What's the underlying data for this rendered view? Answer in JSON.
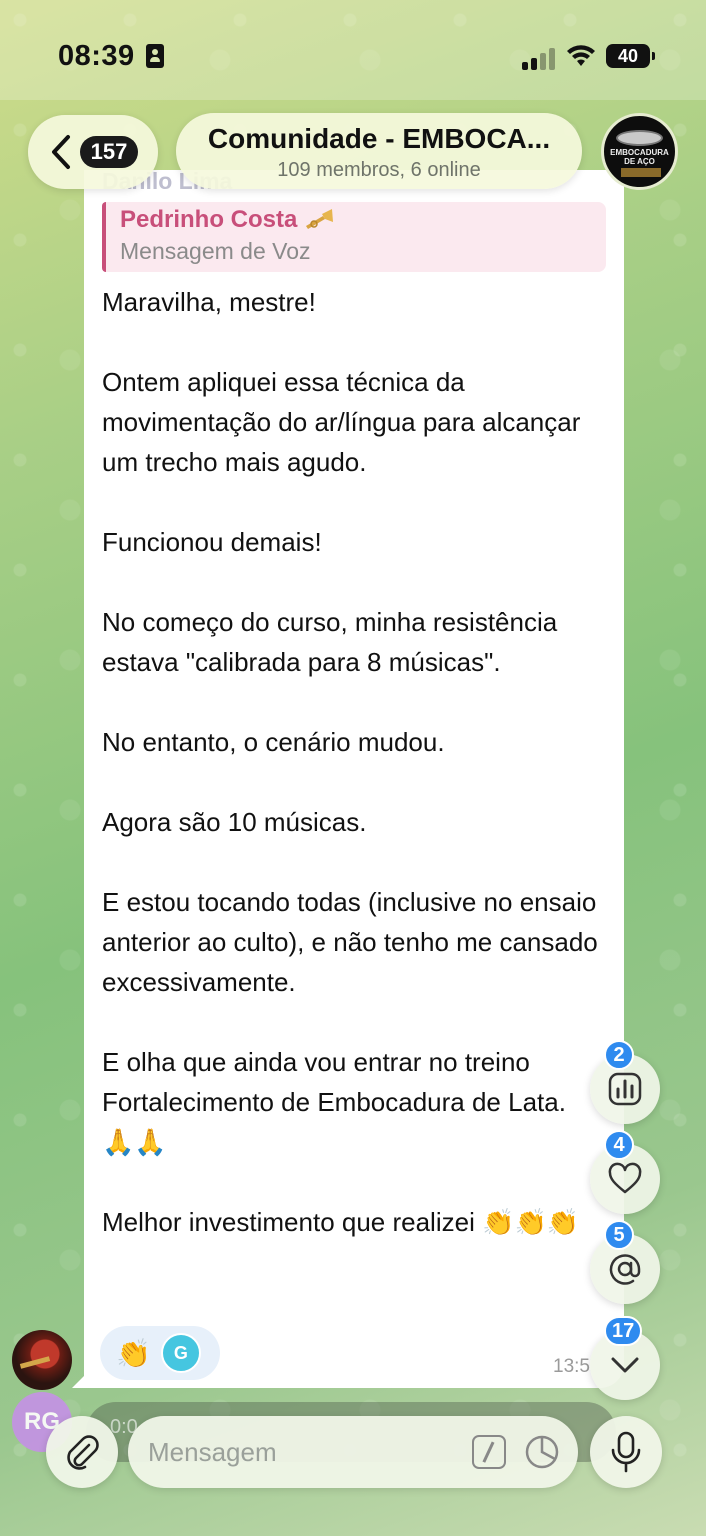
{
  "status_bar": {
    "time": "08:39",
    "battery": "40"
  },
  "header": {
    "unread_count": "157",
    "title": "Comunidade - EMBOCA...",
    "subtitle": "109 membros, 6 online",
    "group_avatar_text": "EMBOCADURA DE AÇO"
  },
  "message": {
    "sender": "Danilo Lima",
    "reply": {
      "name": "Pedrinho Costa",
      "text": "Mensagem de Voz",
      "icon": "trumpet-icon"
    },
    "text": "Maravilha, mestre!\n\nOntem apliquei essa técnica da movimentação do ar/língua para alcançar um trecho mais agudo.\n\nFuncionou demais!\n\nNo começo do curso, minha resistência estava \"calibrada para 8 músicas\".\n\nNo entanto, o cenário mudou.\n\nAgora são 10 músicas.\n\nE estou tocando todas (inclusive no ensaio anterior ao culto), e não tenho me cansado excessivamente.\n\nE olha que ainda vou entrar no treino Fortalecimento de Embocadura de Lata. 🙏🙏\n\nMelhor investimento que realizei 👏👏👏",
    "reaction_emoji": "👏",
    "reactor_initial": "G",
    "time": "13:5"
  },
  "avatars": {
    "rg_initials": "RG"
  },
  "floating_buttons": {
    "polls_count": "2",
    "reactions_count": "4",
    "mentions_count": "5",
    "scroll_down_count": "17"
  },
  "input": {
    "placeholder": "Mensagem",
    "voice_preview_time": "0:0"
  },
  "colors": {
    "accent": "#2f8bef",
    "reply_accent": "#c84f7a"
  }
}
